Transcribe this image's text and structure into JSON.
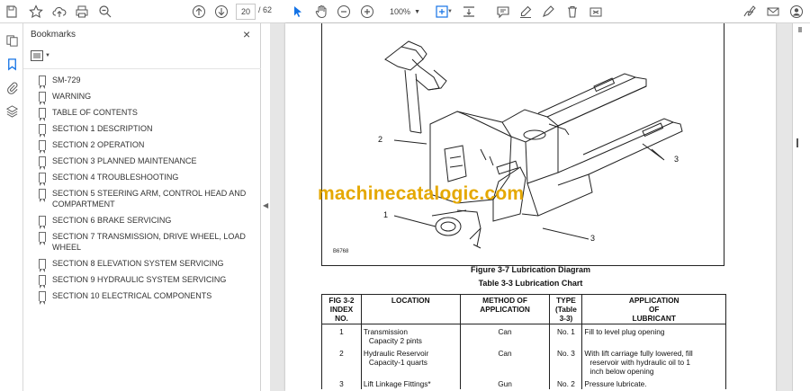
{
  "toolbar": {
    "page_current": "20",
    "page_total": "/ 62",
    "zoom": "100%"
  },
  "bookmarks": {
    "title": "Bookmarks",
    "close": "×",
    "items": [
      {
        "label": "SM-729"
      },
      {
        "label": "WARNING"
      },
      {
        "label": "TABLE OF CONTENTS"
      },
      {
        "label": "SECTION 1 DESCRIPTION"
      },
      {
        "label": "SECTION 2 OPERATION"
      },
      {
        "label": "SECTION 3 PLANNED MAINTENANCE"
      },
      {
        "label": "SECTION 4 TROUBLESHOOTING"
      },
      {
        "label": "SECTION 5 STEERING ARM, CONTROL HEAD AND COMPARTMENT"
      },
      {
        "label": "SECTION 6 BRAKE SERVICING"
      },
      {
        "label": "SECTION 7 TRANSMISSION, DRIVE WHEEL, LOAD WHEEL"
      },
      {
        "label": "SECTION 8 ELEVATION SYSTEM SERVICING"
      },
      {
        "label": "SECTION 9 HYDRAULIC SYSTEM SERVICING"
      },
      {
        "label": "SECTION 10 ELECTRICAL COMPONENTS"
      }
    ]
  },
  "document": {
    "figure_code": "B6768",
    "callouts": {
      "c1": "1",
      "c2": "2",
      "c3a": "3",
      "c3b": "3"
    },
    "figure_caption": "Figure 3-7  Lubrication Diagram",
    "table_caption": "Table 3-3  Lubrication Chart",
    "watermark": "machinecatalogic.com",
    "table": {
      "headers": {
        "index_l1": "FIG 3-2",
        "index_l2": "INDEX",
        "index_l3": "NO.",
        "location": "LOCATION",
        "method_l1": "METHOD OF",
        "method_l2": "APPLICATION",
        "type_l1": "TYPE",
        "type_l2": "(Table",
        "type_l3": "3-3)",
        "app_l1": "APPLICATION",
        "app_l2": "OF",
        "app_l3": "LUBRICANT"
      },
      "rows": [
        {
          "index": "1",
          "loc_l1": "Transmission",
          "loc_l2": "Capacity 2 pints",
          "method": "Can",
          "type": "No. 1",
          "app_l1": "Fill to level plug opening",
          "app_l2": "",
          "app_l3": ""
        },
        {
          "index": "2",
          "loc_l1": "Hydraulic Reservoir",
          "loc_l2": "Capacity-1 quarts",
          "method": "Can",
          "type": "No. 3",
          "app_l1": "With lift carriage fully lowered, fill",
          "app_l2": "reservoir with hydraulic oil to 1",
          "app_l3": "inch below opening"
        },
        {
          "index": "3",
          "loc_l1": "Lift Linkage Fittings*",
          "loc_l2": "",
          "method": "Gun",
          "type": "No. 2",
          "app_l1": "Pressure lubricate.",
          "app_l2": "",
          "app_l3": ""
        }
      ]
    }
  },
  "colors": {
    "accent": "#1473e6",
    "watermark": "#e5a800"
  }
}
